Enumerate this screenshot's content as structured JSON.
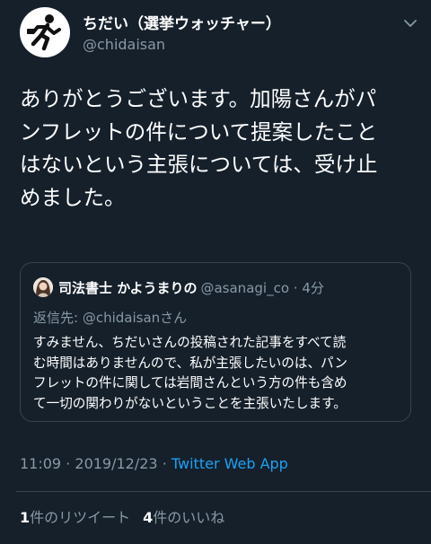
{
  "author": {
    "display_name": "ちだい（選挙ウォッチャー）",
    "handle": "@chidaisan",
    "avatar_icon": "running-figure-icon",
    "menu_icon": "chevron-down-icon"
  },
  "tweet": {
    "text_lines": [
      "ありがとうございます。加陽さんがパ",
      "ンフレットの件について提案したこと",
      "はないという主張については、受け止",
      "めました。"
    ],
    "time": "11:09",
    "separator": "·",
    "date": "2019/12/23",
    "app": "Twitter Web App",
    "retweet_count": "1",
    "retweet_label": "件のリツイート",
    "like_count": "4",
    "like_label": "件のいいね"
  },
  "quoted_tweet": {
    "display_name": "司法書士 かようまりの",
    "handle": "@asanagi_co",
    "separator": "·",
    "time": "4分",
    "reply_prefix": "返信先: ",
    "reply_handle": "@chidaisan",
    "reply_suffix": "さん",
    "body_lines": [
      "すみません、ちだいさんの投稿された記事をすべて読",
      "む時間はありませんので、私が主張したいのは、パン",
      "フレットの件に関しては岩間さんという方の件も含め",
      "て一切の関わりがないということを主張いたします。"
    ]
  },
  "colors": {
    "background": "#15202b",
    "text": "#ffffff",
    "muted": "#8899a6",
    "link": "#1da1f2",
    "border": "#38444d"
  }
}
